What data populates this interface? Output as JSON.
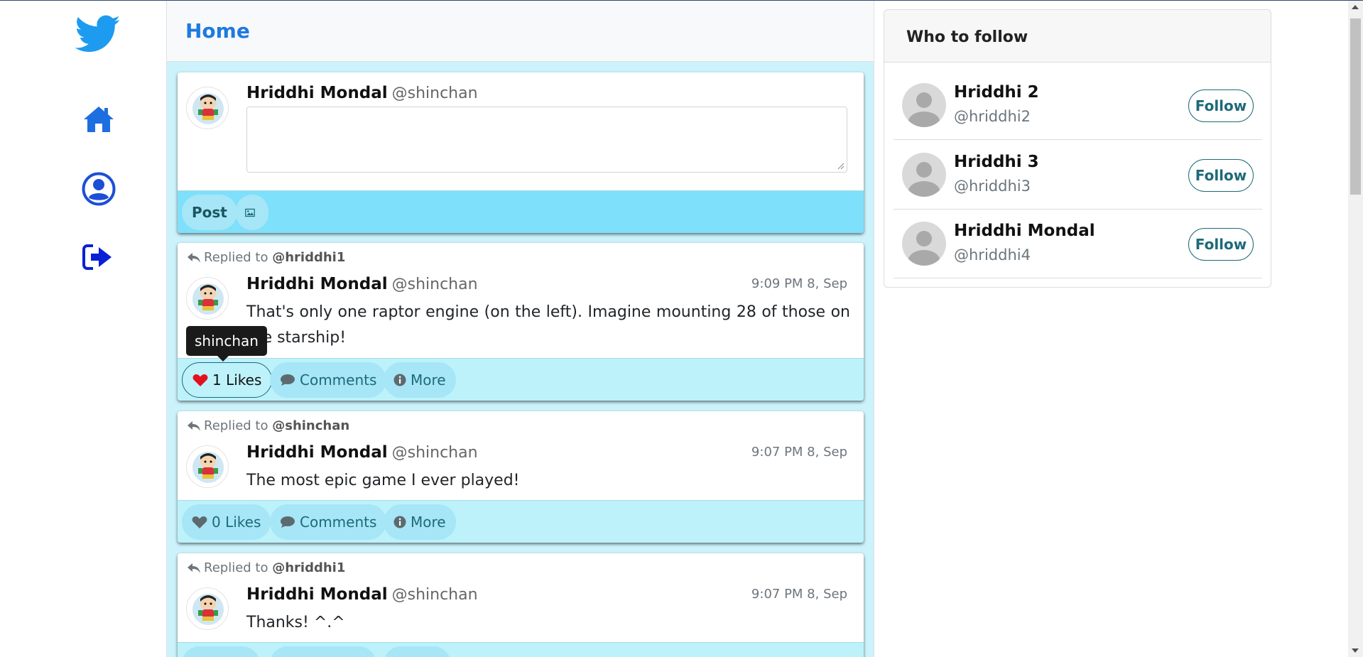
{
  "header": {
    "title": "Home"
  },
  "nav": {
    "logo_icon": "twitter-bird-icon",
    "items": [
      {
        "icon": "home-icon"
      },
      {
        "icon": "user-circle-icon"
      },
      {
        "icon": "sign-out-icon"
      }
    ]
  },
  "composer": {
    "name": "Hriddhi Mondal",
    "handle": "@shinchan",
    "placeholder": "",
    "post_label": "Post",
    "image_icon": "image-icon"
  },
  "tooltip": {
    "text": "shinchan"
  },
  "tweets": [
    {
      "replied_prefix": "Replied to",
      "replied_to": "@hriddhi1",
      "name": "Hriddhi Mondal",
      "handle": "@shinchan",
      "time": "9:09 PM 8, Sep",
      "text": "That's only one raptor engine (on the left). Imagine mounting 28 of those on the starship!",
      "likes": "1 Likes",
      "liked": true,
      "comments": "Comments",
      "more": "More"
    },
    {
      "replied_prefix": "Replied to",
      "replied_to": "@shinchan",
      "name": "Hriddhi Mondal",
      "handle": "@shinchan",
      "time": "9:07 PM 8, Sep",
      "text": "The most epic game I ever played!",
      "likes": "0 Likes",
      "liked": false,
      "comments": "Comments",
      "more": "More"
    },
    {
      "replied_prefix": "Replied to",
      "replied_to": "@hriddhi1",
      "name": "Hriddhi Mondal",
      "handle": "@shinchan",
      "time": "9:07 PM 8, Sep",
      "text": "Thanks! ^.^"
    }
  ],
  "who_to_follow": {
    "title": "Who to follow",
    "users": [
      {
        "name": "Hriddhi 2",
        "handle": "@hriddhi2",
        "button": "Follow"
      },
      {
        "name": "Hriddhi 3",
        "handle": "@hriddhi3",
        "button": "Follow"
      },
      {
        "name": "Hriddhi Mondal",
        "handle": "@hriddhi4",
        "button": "Follow"
      }
    ]
  },
  "colors": {
    "brand_blue": "#1d7ae0",
    "nav_blue": "#1d4fd6",
    "feed_bg": "#ccf2fb",
    "footer_bg": "#bdf2fb",
    "composer_footer": "#7ee0fb",
    "heart_red": "#e3101d",
    "teal": "#1e6a78"
  }
}
